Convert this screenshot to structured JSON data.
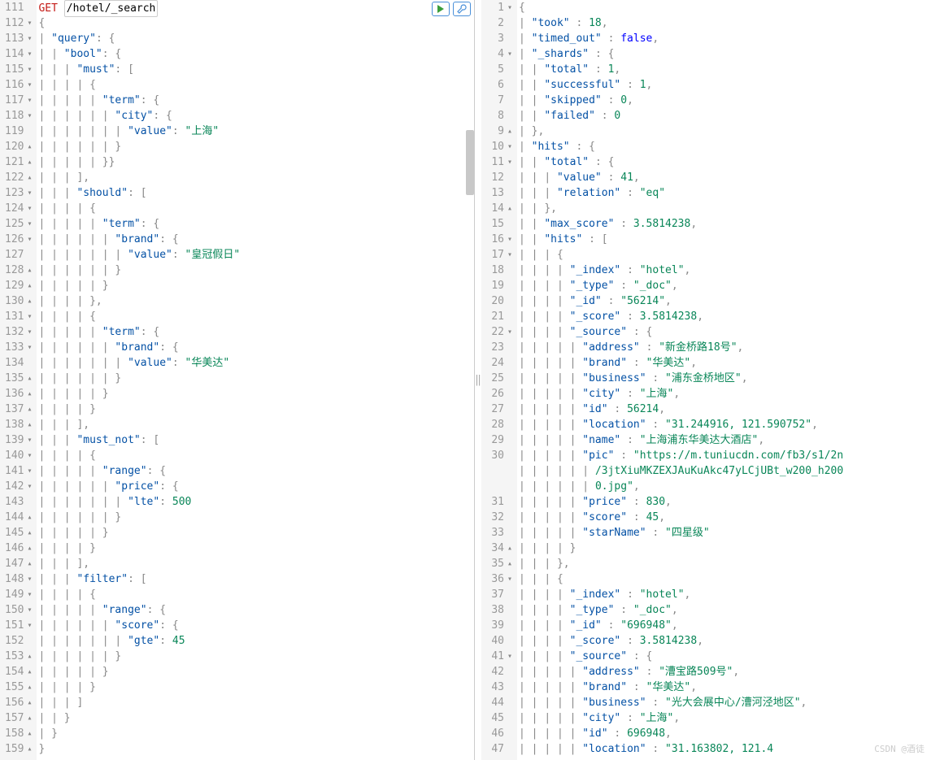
{
  "request": {
    "method": "GET",
    "path": "/hotel/_search",
    "startLine": 111,
    "body": {
      "query": {
        "bool": {
          "must": [
            {
              "term": {
                "city": {
                  "value": "上海"
                }
              }
            }
          ],
          "should": [
            {
              "term": {
                "brand": {
                  "value": "皇冠假日"
                }
              }
            },
            {
              "term": {
                "brand": {
                  "value": "华美达"
                }
              }
            }
          ],
          "must_not": [
            {
              "range": {
                "price": {
                  "lte": 500
                }
              }
            }
          ],
          "filter": [
            {
              "range": {
                "score": {
                  "gte": 45
                }
              }
            }
          ]
        }
      }
    }
  },
  "response": {
    "startLine": 1,
    "body": {
      "took": 18,
      "timed_out": false,
      "_shards": {
        "total": 1,
        "successful": 1,
        "skipped": 0,
        "failed": 0
      },
      "hits": {
        "total": {
          "value": 41,
          "relation": "eq"
        },
        "max_score": 3.5814238,
        "hits": [
          {
            "_index": "hotel",
            "_type": "_doc",
            "_id": "56214",
            "_score": 3.5814238,
            "_source": {
              "address": "新金桥路18号",
              "brand": "华美达",
              "business": "浦东金桥地区",
              "city": "上海",
              "id": 56214,
              "location": "31.244916, 121.590752",
              "name": "上海浦东华美达大酒店",
              "pic": "https://m.tuniucdn.com/fb3/s1/2n9c/3jtXiuMKZEXJAuKuAkc47yLCjUBt_w200_h200_c1_t0.jpg",
              "price": 830,
              "score": 45,
              "starName": "四星级"
            }
          },
          {
            "_index": "hotel",
            "_type": "_doc",
            "_id": "696948",
            "_score": 3.5814238,
            "_source": {
              "address": "漕宝路509号",
              "brand": "华美达",
              "business": "光大会展中心/漕河泾地区",
              "city": "上海",
              "id": 696948,
              "location": "31.163802, 121.4"
            }
          }
        ]
      }
    }
  },
  "watermark": "CSDN @酒徒"
}
